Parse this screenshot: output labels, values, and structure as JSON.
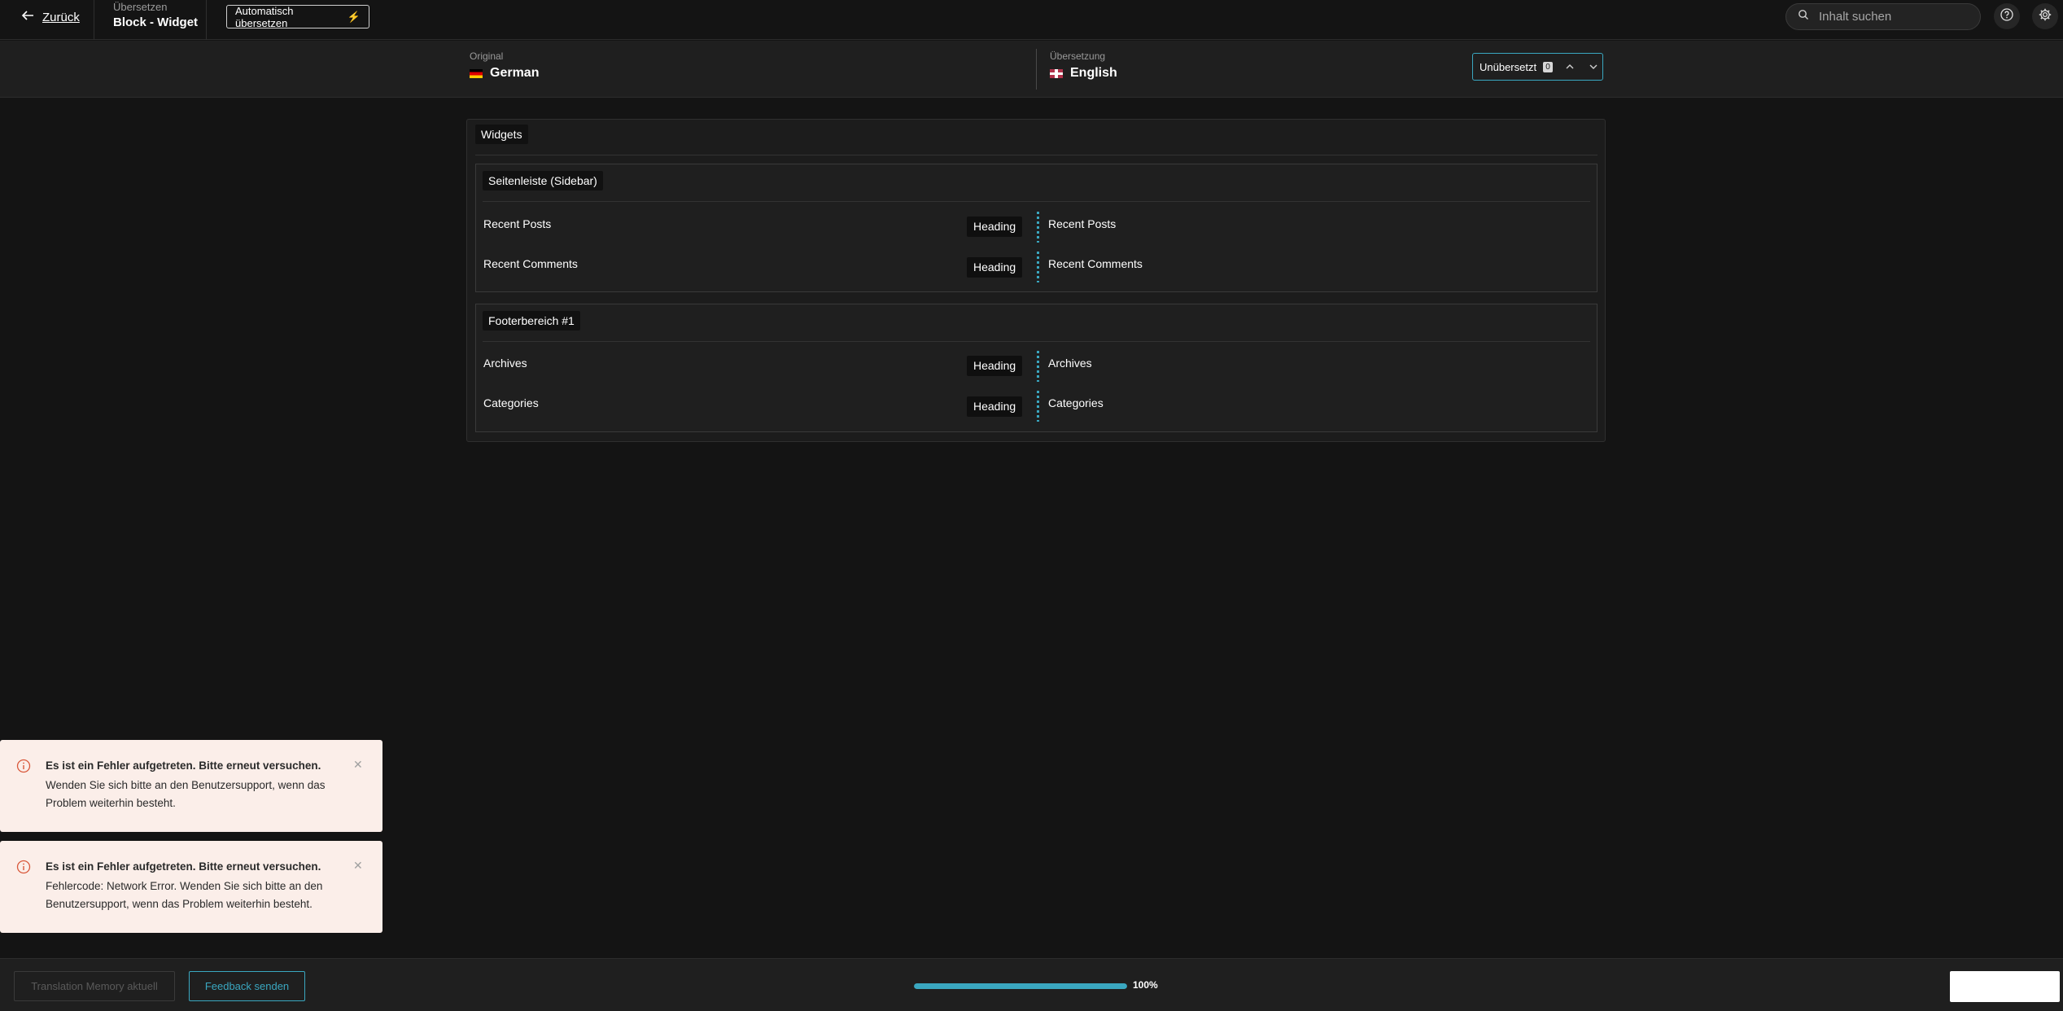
{
  "topbar": {
    "back_label": "Zurück",
    "crumb_top": "Übersetzen",
    "crumb_title": "Block - Widget",
    "auto_translate_label": "Automatisch übersetzen",
    "search_placeholder": "Inhalt suchen"
  },
  "languages": {
    "original_caption": "Original",
    "original_name": "German",
    "translation_caption": "Übersetzung",
    "translation_name": "English",
    "filter_label": "Unübersetzt",
    "filter_count": "0"
  },
  "content": {
    "section_title": "Widgets",
    "groups": [
      {
        "title": "Seitenleiste (Sidebar)",
        "rows": [
          {
            "source": "Recent Posts",
            "type": "Heading",
            "target": "Recent Posts"
          },
          {
            "source": "Recent Comments",
            "type": "Heading",
            "target": "Recent Comments"
          }
        ]
      },
      {
        "title": "Footerbereich #1",
        "rows": [
          {
            "source": "Archives",
            "type": "Heading",
            "target": "Archives"
          },
          {
            "source": "Categories",
            "type": "Heading",
            "target": "Categories"
          }
        ]
      }
    ]
  },
  "toasts": [
    {
      "title": "Es ist ein Fehler aufgetreten. Bitte erneut versuchen.",
      "message": "Wenden Sie sich bitte an den Benutzersupport, wenn das Problem weiterhin besteht."
    },
    {
      "title": "Es ist ein Fehler aufgetreten. Bitte erneut versuchen.",
      "message": "Fehlercode: Network Error. Wenden Sie sich bitte an den Benutzersupport, wenn das Problem weiterhin besteht."
    }
  ],
  "footer": {
    "tm_label": "Translation Memory aktuell",
    "feedback_label": "Feedback senden",
    "progress_value": 100,
    "progress_label": "100%"
  },
  "colors": {
    "accent": "#3aa7c0",
    "background": "#141414",
    "toast_background": "#fbeee9"
  }
}
